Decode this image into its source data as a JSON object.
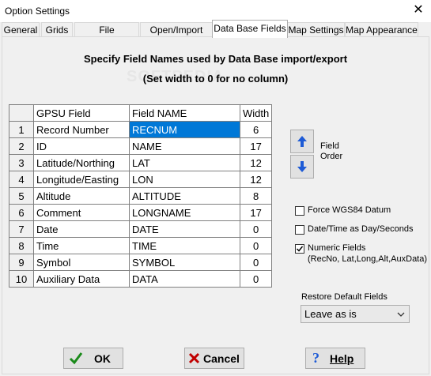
{
  "window": {
    "title": "Option Settings",
    "close_glyph": "✕"
  },
  "tabs": [
    {
      "label": "General"
    },
    {
      "label": "Grids"
    },
    {
      "label": "File Categories"
    },
    {
      "label": "Open/Import files"
    },
    {
      "label": "Data Base Fields"
    },
    {
      "label": "Map Settings"
    },
    {
      "label": "Map Appearance"
    }
  ],
  "active_tab": "Data Base Fields",
  "panel": {
    "heading": "Specify Field Names used by Data Base import/export",
    "subheading": "(Set width to 0 for no column)",
    "watermark": "SOFTPEDIA"
  },
  "table": {
    "columns": [
      "GPSU Field",
      "Field NAME",
      "Width"
    ],
    "rows": [
      {
        "num": "1",
        "gpsu": "Record Number",
        "name": "RECNUM",
        "width": "6"
      },
      {
        "num": "2",
        "gpsu": "ID",
        "name": "NAME",
        "width": "17"
      },
      {
        "num": "3",
        "gpsu": "Latitude/Northing",
        "name": "LAT",
        "width": "12"
      },
      {
        "num": "4",
        "gpsu": "Longitude/Easting",
        "name": "LON",
        "width": "12"
      },
      {
        "num": "5",
        "gpsu": "Altitude",
        "name": "ALTITUDE",
        "width": "8"
      },
      {
        "num": "6",
        "gpsu": "Comment",
        "name": "LONGNAME",
        "width": "17"
      },
      {
        "num": "7",
        "gpsu": "Date",
        "name": "DATE",
        "width": "0"
      },
      {
        "num": "8",
        "gpsu": "Time",
        "name": "TIME",
        "width": "0"
      },
      {
        "num": "9",
        "gpsu": "Symbol",
        "name": "SYMBOL",
        "width": "0"
      },
      {
        "num": "10",
        "gpsu": "Auxiliary Data",
        "name": "DATA",
        "width": "0"
      }
    ],
    "selected_cell": "RECNUM"
  },
  "field_order": {
    "label_line1": "Field",
    "label_line2": "Order",
    "up_icon": "arrow-up",
    "down_icon": "arrow-down"
  },
  "options": {
    "force_wgs84": {
      "label": "Force WGS84 Datum",
      "checked": false
    },
    "date_time_days": {
      "label": "Date/Time as Day/Seconds",
      "checked": false
    },
    "numeric_fields": {
      "label": "Numeric Fields",
      "sublabel": "(RecNo, Lat,Long,Alt,AuxData)",
      "checked": true
    }
  },
  "restore": {
    "label": "Restore Default Fields",
    "value": "Leave as is"
  },
  "buttons": {
    "ok": "OK",
    "cancel": "Cancel",
    "help": "Help"
  },
  "colors": {
    "selection": "#0078d7",
    "ok_check": "#1a8a1a",
    "cancel_x": "#c00000",
    "help_q": "#1e5bd6",
    "arrow_blue": "#1e5bd6"
  }
}
